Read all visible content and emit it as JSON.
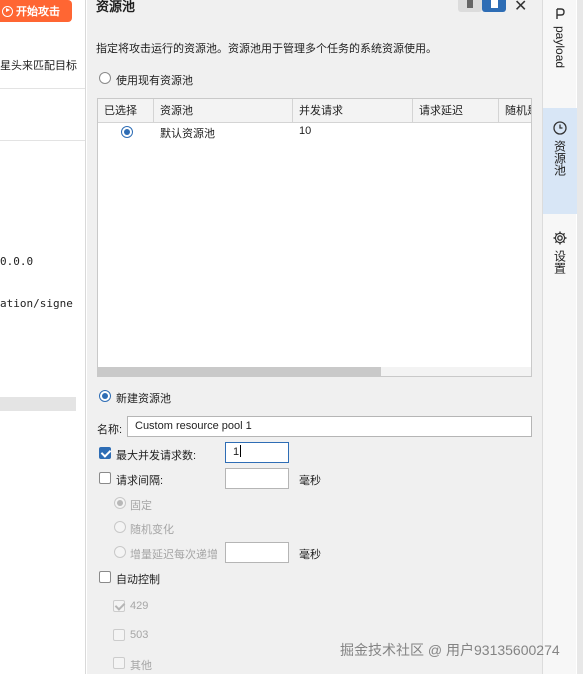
{
  "left_panel": {
    "start_attack_label": "开始攻击",
    "hint_text": "星头来匹配目标",
    "mono_line_1": "0.0.0",
    "mono_line_2": "ation/signe"
  },
  "panel": {
    "title": "资源池",
    "description": "指定将攻击运行的资源池。资源池用于管理多个任务的系统资源使用。",
    "use_existing_label": "使用现有资源池",
    "table": {
      "columns": [
        "已选择",
        "资源池",
        "并发请求",
        "请求延迟",
        "随机是"
      ],
      "rows": [
        {
          "selected": true,
          "pool": "默认资源池",
          "concurrent": "10",
          "delay": "",
          "random": ""
        }
      ]
    },
    "new_pool_label": "新建资源池",
    "name_label": "名称:",
    "name_value": "Custom resource pool 1",
    "max_concurrent_label": "最大并发请求数:",
    "max_concurrent_value": "1",
    "request_interval_label": "请求间隔:",
    "request_interval_value": "",
    "ms_unit": "毫秒",
    "fixed_label": "固定",
    "random_label": "随机变化",
    "increment_label": "增量延迟每次递增",
    "increment_value": "",
    "ms_unit_2": "毫秒",
    "auto_control_label": "自动控制",
    "code_429": "429",
    "code_503": "503",
    "other_label": "其他"
  },
  "right_tabs": {
    "payload_label": "payload",
    "resource_pool_label": "资源池",
    "settings_label": "设置"
  },
  "watermark": "掘金技术社区 @ 用户93135600274",
  "colors": {
    "accent": "#2e6db5",
    "start_button": "#ff6633",
    "active_tab": "#d8e6f6"
  }
}
